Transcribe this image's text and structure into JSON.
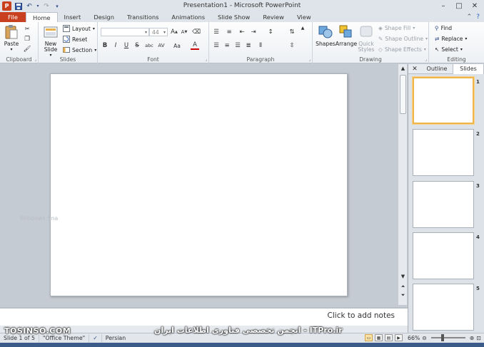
{
  "window": {
    "title": "Presentation1 - Microsoft PowerPoint",
    "app_icon": "P",
    "qat": [
      "save-icon",
      "undo-icon",
      "redo-icon",
      "customize-icon"
    ],
    "controls": [
      "–",
      "□",
      "✕"
    ]
  },
  "tabs": [
    {
      "label": "File",
      "kind": "file"
    },
    {
      "label": "Home",
      "kind": "active"
    },
    {
      "label": "Insert"
    },
    {
      "label": "Design"
    },
    {
      "label": "Transitions"
    },
    {
      "label": "Animations"
    },
    {
      "label": "Slide Show"
    },
    {
      "label": "Review"
    },
    {
      "label": "View"
    }
  ],
  "ribbon": {
    "clipboard": {
      "label": "Clipboard",
      "paste": "Paste"
    },
    "slides": {
      "label": "Slides",
      "new_slide": "New Slide",
      "layout": "Layout",
      "reset": "Reset",
      "section": "Section"
    },
    "font": {
      "label": "Font",
      "font_name": "",
      "font_size": "44",
      "buttons": [
        "B",
        "I",
        "U",
        "S",
        "abc",
        "AV",
        "Aa",
        "A"
      ]
    },
    "paragraph": {
      "label": "Paragraph"
    },
    "drawing": {
      "label": "Drawing",
      "shapes": "Shapes",
      "arrange": "Arrange",
      "quick_styles": "Quick Styles",
      "shape_fill": "Shape Fill",
      "shape_outline": "Shape Outline",
      "shape_effects": "Shape Effects"
    },
    "editing": {
      "label": "Editing",
      "find": "Find",
      "replace": "Replace",
      "select": "Select"
    }
  },
  "editor": {
    "watermark": "Windows Sna",
    "notes_placeholder": "Click to add notes"
  },
  "pane": {
    "tabs": {
      "outline": "Outline",
      "slides": "Slides"
    },
    "thumbnails": [
      {
        "num": "1",
        "selected": true
      },
      {
        "num": "2",
        "selected": false
      },
      {
        "num": "3",
        "selected": false
      },
      {
        "num": "4",
        "selected": false
      },
      {
        "num": "5",
        "selected": false
      }
    ]
  },
  "status": {
    "slide": "Slide 1 of 5",
    "theme": "\"Office Theme\"",
    "language": "Persian",
    "zoom": "66%",
    "zoom_fraction": 0.66
  },
  "watermarks": {
    "left": "TOSINSO.COM",
    "center": "انجمن تخصصی فناوری اطلاعات ایران - ITPro.ir"
  },
  "colors": {
    "file_tab": "#c8401f",
    "selected_thumb": "#f0b54a",
    "ribbon_bg": "#fdfdfd",
    "workspace_bg": "#c5cbd3"
  }
}
